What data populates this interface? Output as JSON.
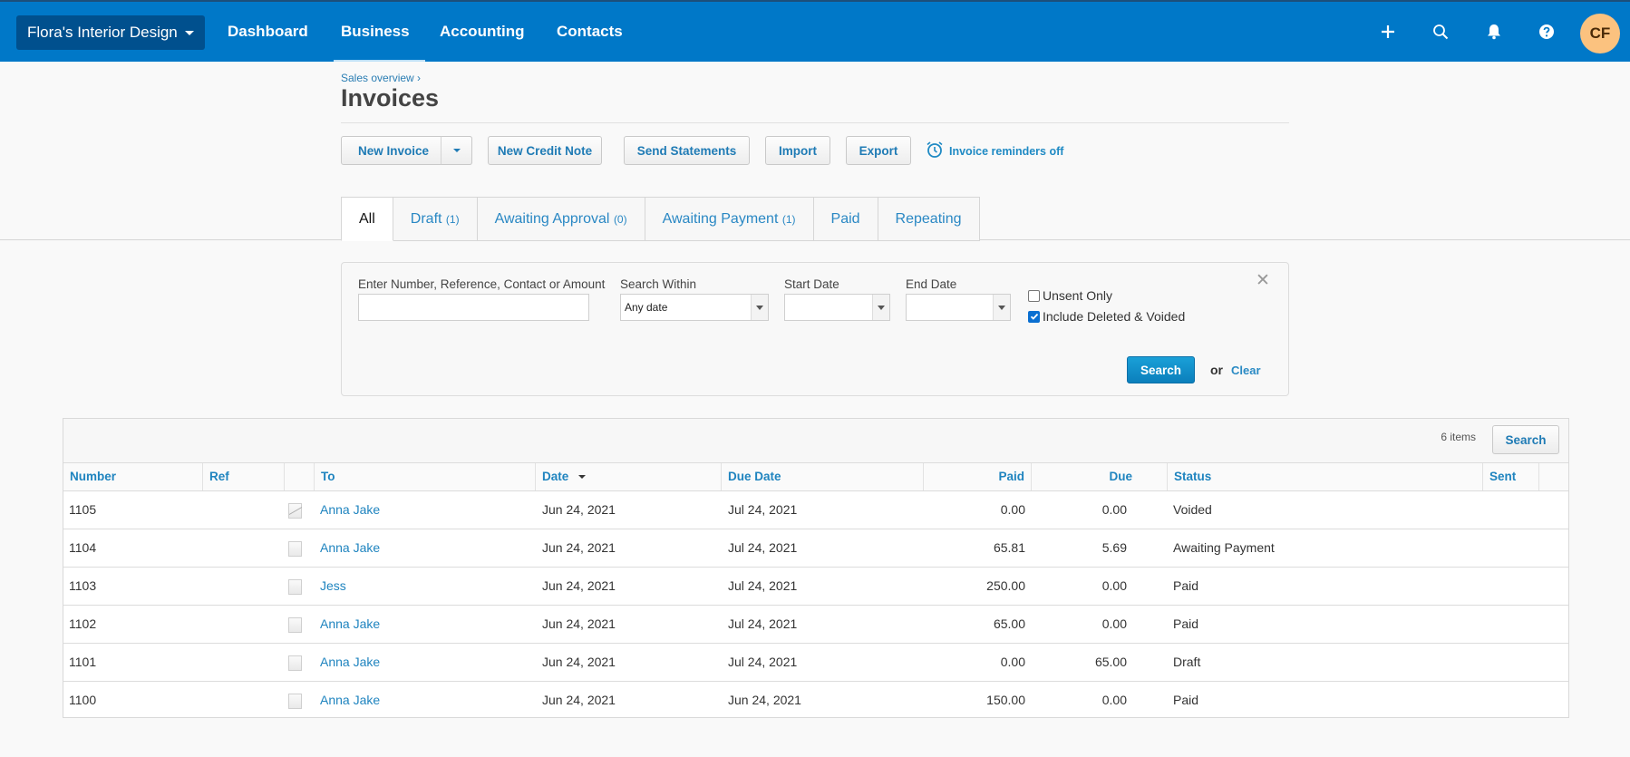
{
  "nav": {
    "org_name": "Flora's Interior Design",
    "links": [
      "Dashboard",
      "Business",
      "Accounting",
      "Contacts"
    ],
    "active": "Business",
    "icons": [
      "plus-icon",
      "search-icon",
      "bell-icon",
      "help-icon"
    ],
    "avatar_initials": "CF"
  },
  "header": {
    "breadcrumb": "Sales overview ›",
    "title": "Invoices",
    "buttons": {
      "new_invoice": "New Invoice",
      "new_credit_note": "New Credit Note",
      "send_statements": "Send Statements",
      "import": "Import",
      "export": "Export"
    },
    "reminders": "Invoice reminders off"
  },
  "tabs": [
    {
      "label": "All",
      "count": ""
    },
    {
      "label": "Draft",
      "count": "(1)"
    },
    {
      "label": "Awaiting Approval",
      "count": "(0)"
    },
    {
      "label": "Awaiting Payment",
      "count": "(1)"
    },
    {
      "label": "Paid",
      "count": ""
    },
    {
      "label": "Repeating",
      "count": ""
    }
  ],
  "filter": {
    "search_label": "Enter Number, Reference, Contact or Amount",
    "search_value": "",
    "within_label": "Search Within",
    "within_value": "Any date",
    "start_label": "Start Date",
    "start_value": "",
    "end_label": "End Date",
    "end_value": "",
    "unsent_only": {
      "label": "Unsent Only",
      "checked": false
    },
    "include_deleted": {
      "label": "Include Deleted & Voided",
      "checked": true
    },
    "search_button": "Search",
    "or": "or",
    "clear": "Clear"
  },
  "table": {
    "item_count": "6 items",
    "search_button": "Search",
    "columns": [
      "Number",
      "Ref",
      "",
      "To",
      "Date",
      "Due Date",
      "Paid",
      "Due",
      "",
      "Status",
      "Sent"
    ],
    "rows": [
      {
        "number": "1105",
        "ref": "",
        "to": "Anna Jake",
        "date": "Jun 24, 2021",
        "due_date": "Jul 24, 2021",
        "paid": "0.00",
        "due": "0.00",
        "status": "Voided",
        "sent": "",
        "voided": true
      },
      {
        "number": "1104",
        "ref": "",
        "to": "Anna Jake",
        "date": "Jun 24, 2021",
        "due_date": "Jul 24, 2021",
        "paid": "65.81",
        "due": "5.69",
        "status": "Awaiting Payment",
        "sent": ""
      },
      {
        "number": "1103",
        "ref": "",
        "to": "Jess",
        "date": "Jun 24, 2021",
        "due_date": "Jul 24, 2021",
        "paid": "250.00",
        "due": "0.00",
        "status": "Paid",
        "sent": ""
      },
      {
        "number": "1102",
        "ref": "",
        "to": "Anna Jake",
        "date": "Jun 24, 2021",
        "due_date": "Jul 24, 2021",
        "paid": "65.00",
        "due": "0.00",
        "status": "Paid",
        "sent": ""
      },
      {
        "number": "1101",
        "ref": "",
        "to": "Anna Jake",
        "date": "Jun 24, 2021",
        "due_date": "Jul 24, 2021",
        "paid": "0.00",
        "due": "65.00",
        "status": "Draft",
        "sent": ""
      },
      {
        "number": "1100",
        "ref": "",
        "to": "Anna Jake",
        "date": "Jun 24, 2021",
        "due_date": "Jun 24, 2021",
        "paid": "150.00",
        "due": "0.00",
        "status": "Paid",
        "sent": ""
      }
    ]
  }
}
